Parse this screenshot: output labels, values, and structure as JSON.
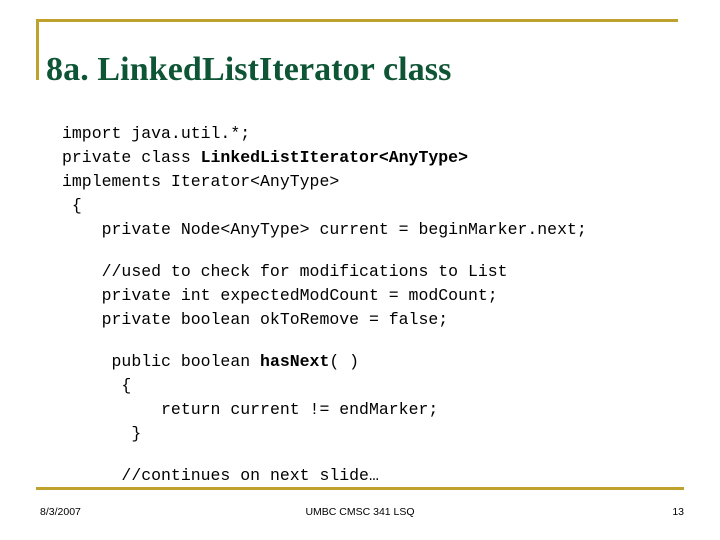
{
  "slide": {
    "title": "8a. LinkedListIterator class",
    "accent_color": "#BFA12E",
    "title_color": "#0E5535",
    "background_color": "#FFFFFF"
  },
  "code": {
    "lines": [
      {
        "indent": "",
        "text": "import java.util.*;",
        "bold": ""
      },
      {
        "indent": "",
        "text": "private class ",
        "bold": "LinkedListIterator<AnyType>"
      },
      {
        "indent": "",
        "text": "implements Iterator<AnyType>",
        "bold": ""
      },
      {
        "indent": " ",
        "text": "{",
        "bold": ""
      },
      {
        "indent": "    ",
        "text": "private Node<AnyType> current = beginMarker.next;",
        "bold": ""
      },
      {
        "indent": "",
        "text": "",
        "bold": ""
      },
      {
        "indent": "    ",
        "text": "//used to check for modifications to List",
        "bold": ""
      },
      {
        "indent": "    ",
        "text": "private int expectedModCount = modCount;",
        "bold": ""
      },
      {
        "indent": "    ",
        "text": "private boolean okToRemove = false;",
        "bold": ""
      },
      {
        "indent": "",
        "text": "",
        "bold": ""
      },
      {
        "indent": "     ",
        "text": "public boolean ",
        "bold": "hasNext",
        "after": "( )"
      },
      {
        "indent": "     ",
        "text": " {",
        "bold": ""
      },
      {
        "indent": "     ",
        "text": "     return current != endMarker;",
        "bold": ""
      },
      {
        "indent": "     ",
        "text": "  }",
        "bold": ""
      },
      {
        "indent": "",
        "text": "",
        "bold": ""
      },
      {
        "indent": "     ",
        "text": " //continues on next slide…",
        "bold": ""
      }
    ]
  },
  "footer": {
    "date": "8/3/2007",
    "center": "UMBC CMSC 341 LSQ",
    "page_number": "13"
  }
}
